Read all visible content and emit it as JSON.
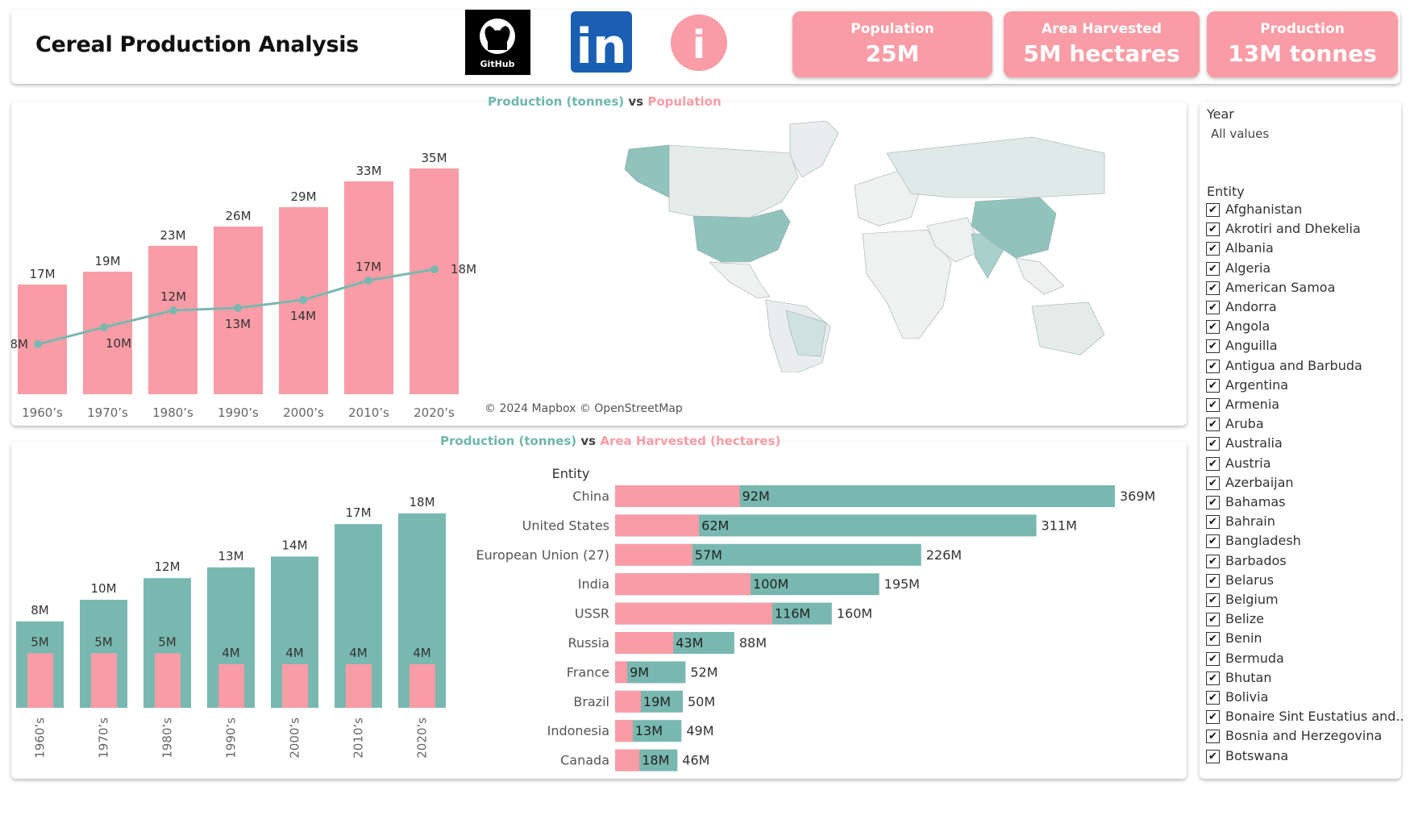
{
  "title": "Cereal Production Analysis",
  "icons": [
    {
      "name": "github-icon",
      "label": "GitHub"
    },
    {
      "name": "linkedin-icon",
      "label": "in"
    },
    {
      "name": "info-icon",
      "label": "i"
    }
  ],
  "kpis": [
    {
      "label": "Population",
      "value": "25M"
    },
    {
      "label": "Area Harvested",
      "value": "5M hectares"
    },
    {
      "label": "Production",
      "value": "13M tonnes"
    }
  ],
  "chart1_title": {
    "a": "Production (tonnes)",
    "vs": "vs",
    "b": "Population"
  },
  "chart2_title": {
    "a": "Production (tonnes)",
    "vs": "vs",
    "b": "Area Harvested (hectares)"
  },
  "map_credit": "© 2024 Mapbox © OpenStreetMap",
  "filters": {
    "year_label": "Year",
    "year_value": "All values",
    "entity_label": "Entity",
    "entities": [
      "Afghanistan",
      "Akrotiri and Dhekelia",
      "Albania",
      "Algeria",
      "American Samoa",
      "Andorra",
      "Angola",
      "Anguilla",
      "Antigua and Barbuda",
      "Argentina",
      "Armenia",
      "Aruba",
      "Australia",
      "Austria",
      "Azerbaijan",
      "Bahamas",
      "Bahrain",
      "Bangladesh",
      "Barbados",
      "Belarus",
      "Belgium",
      "Belize",
      "Benin",
      "Bermuda",
      "Bhutan",
      "Bolivia",
      "Bonaire Sint Eustatius and..",
      "Bosnia and Herzegovina",
      "Botswana"
    ]
  },
  "colors": {
    "pink": "#f99ca5",
    "teal": "#78b8b0",
    "tealLight": "#dbe9e7",
    "tealDark": "#6fb7ae"
  },
  "chart_data": [
    {
      "type": "bar",
      "categories": [
        "1960’s",
        "1970’s",
        "1980’s",
        "1990’s",
        "2000’s",
        "2010’s",
        "2020’s"
      ],
      "series": [
        {
          "values": [
            17,
            19,
            23,
            26,
            29,
            33,
            35
          ],
          "labels": [
            "17M",
            "19M",
            "23M",
            "26M",
            "29M",
            "33M",
            "35M"
          ],
          "kind": "bar",
          "color": "#f99ca5"
        },
        {
          "values": [
            8,
            10,
            12,
            13,
            14,
            17,
            18
          ],
          "labels": [
            "8M",
            "10M",
            "12M",
            "13M",
            "14M",
            "17M",
            "18M"
          ],
          "kind": "line",
          "color": "#78b8b0"
        }
      ]
    },
    {
      "type": "bar",
      "categories": [
        "1960’s",
        "1970’s",
        "1980’s",
        "1990’s",
        "2000’s",
        "2010’s",
        "2020’s"
      ],
      "series": [
        {
          "values": [
            8,
            10,
            12,
            13,
            14,
            17,
            18
          ],
          "labels": [
            "8M",
            "10M",
            "12M",
            "13M",
            "14M",
            "17M",
            "18M"
          ],
          "color": "#78b8b0"
        },
        {
          "values": [
            5,
            5,
            5,
            4,
            4,
            4,
            4
          ],
          "labels": [
            "5M",
            "5M",
            "5M",
            "4M",
            "4M",
            "4M",
            "4M"
          ],
          "color": "#f99ca5"
        }
      ]
    },
    {
      "type": "bar",
      "orientation": "horizontal",
      "category_header": "Entity",
      "categories": [
        "China",
        "United States",
        "European Union (27)",
        "India",
        "USSR",
        "Russia",
        "France",
        "Brazil",
        "Indonesia",
        "Canada"
      ],
      "series": [
        {
          "values": [
            369,
            311,
            226,
            195,
            160,
            88,
            52,
            50,
            49,
            46
          ],
          "labels": [
            "369M",
            "311M",
            "226M",
            "195M",
            "160M",
            "88M",
            "52M",
            "50M",
            "49M",
            "46M"
          ],
          "color": "#78b8b0"
        },
        {
          "values": [
            92,
            62,
            57,
            100,
            116,
            43,
            9,
            19,
            13,
            18
          ],
          "labels": [
            "92M",
            "62M",
            "57M",
            "100M",
            "116M",
            "43M",
            "9M",
            "19M",
            "13M",
            "18M"
          ],
          "color": "#f99ca5"
        }
      ]
    },
    {
      "type": "map",
      "highlighted": [
        "United States",
        "China",
        "India",
        "Russia",
        "Canada",
        "Brazil",
        "Alaska"
      ]
    }
  ]
}
